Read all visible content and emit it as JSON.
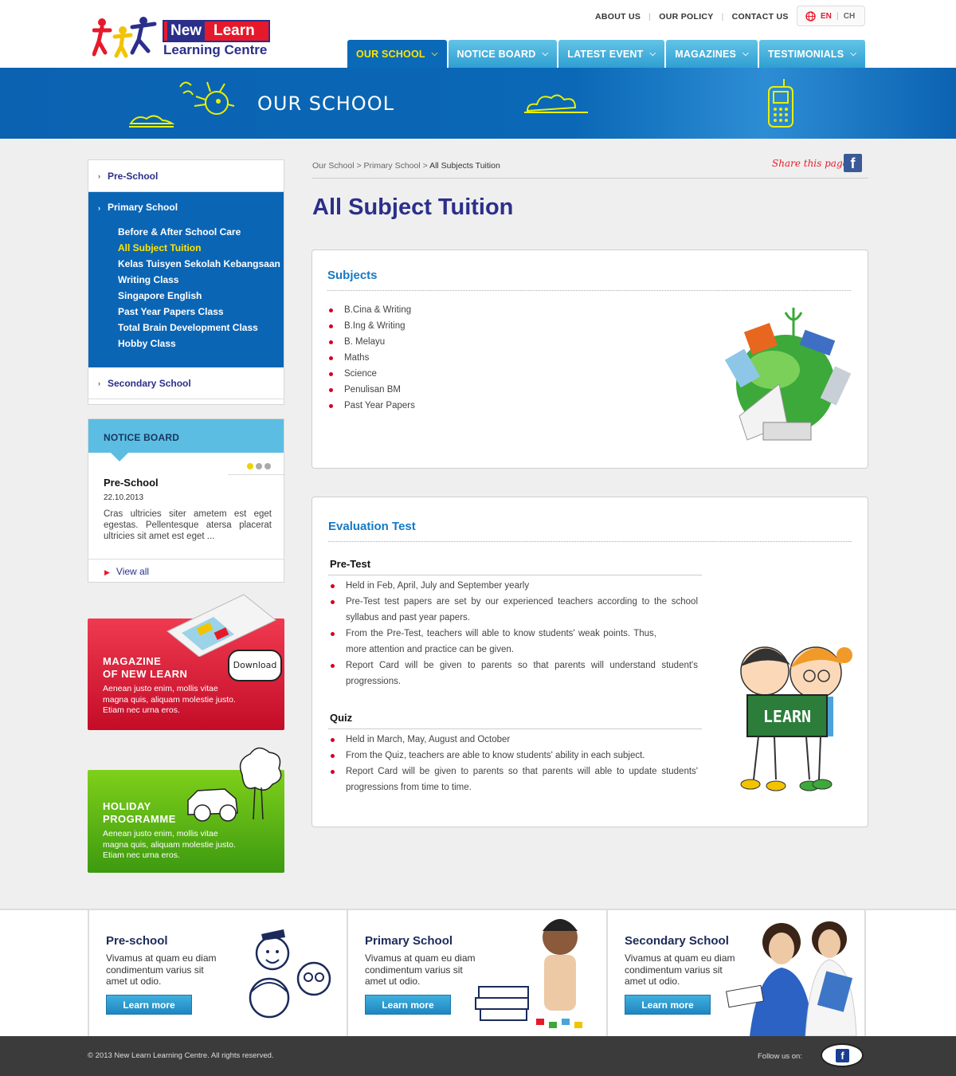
{
  "header": {
    "logo": {
      "word1": "New",
      "word2": "Learn",
      "subtitle": "Learning Centre"
    },
    "top_links": [
      "ABOUT US",
      "OUR POLICY",
      "CONTACT US"
    ],
    "lang": {
      "en": "EN",
      "ch": "CH"
    },
    "nav": [
      {
        "label": "OUR SCHOOL",
        "active": true
      },
      {
        "label": "NOTICE BOARD",
        "active": false
      },
      {
        "label": "LATEST EVENT",
        "active": false
      },
      {
        "label": "MAGAZINES",
        "active": false
      },
      {
        "label": "TESTIMONIALS",
        "active": false
      }
    ]
  },
  "banner": {
    "title": "OUR SCHOOL"
  },
  "sidebar": {
    "menu": {
      "preschool": "Pre-School",
      "primary": "Primary School",
      "primary_items": [
        "Before & After School Care",
        "All Subject Tuition",
        "Kelas Tuisyen Sekolah Kebangsaan",
        "Writing Class",
        "Singapore English",
        "Past Year Papers Class",
        "Total Brain Development Class",
        "Hobby Class"
      ],
      "active_item": "All Subject Tuition",
      "secondary": "Secondary School"
    },
    "notice": {
      "header": "NOTICE BOARD",
      "title": "Pre-School",
      "date": "22.10.2013",
      "text": "Cras ultricies siter ametem est eget egestas. Pellentesque atersa placerat ultricies sit amet est eget ...",
      "view_all": "View all"
    },
    "magazine": {
      "title1": "MAGAZINE",
      "title2": "OF NEW LEARN",
      "text": "Aenean justo enim, mollis vitae magna quis, aliquam molestie justo. Etiam nec urna eros.",
      "download": "Download"
    },
    "holiday": {
      "title1": "HOLIDAY",
      "title2": "PROGRAMME",
      "text": "Aenean justo enim, mollis vitae magna quis, aliquam molestie justo. Etiam nec urna eros."
    }
  },
  "main": {
    "breadcrumb": {
      "a": "Our School",
      "b": "Primary School",
      "c": "All Subjects Tuition",
      "sep": " > "
    },
    "share": "Share this page:",
    "title": "All Subject Tuition",
    "subjects": {
      "heading": "Subjects",
      "items": [
        "B.Cina & Writing",
        "B.Ing & Writing",
        "B. Melayu",
        "Maths",
        "Science",
        "Penulisan BM",
        "Past Year Papers"
      ]
    },
    "evaluation": {
      "heading": "Evaluation Test",
      "pretest": {
        "heading": "Pre-Test",
        "items": [
          "Held in Feb, April, July and September yearly",
          "Pre-Test test papers are set by our experienced teachers according to the school syllabus and past year papers.",
          "From the Pre-Test, teachers will able to know students' weak points. Thus, more attention and practice can be given.",
          "Report Card will be given to parents so that parents will understand student's progressions."
        ]
      },
      "quiz": {
        "heading": "Quiz",
        "items": [
          "Held in March, May, August and October",
          "From the Quiz, teachers are able to know students' ability in each subject.",
          "Report Card will be given to parents so that parents will able to update students' progressions from time to time."
        ]
      },
      "board_text": "LEARN"
    }
  },
  "footer_boxes": [
    {
      "title": "Pre-school",
      "text": "Vivamus at quam eu diam condimentum varius sit amet ut odio.",
      "button": "Learn more"
    },
    {
      "title": "Primary School",
      "text": "Vivamus at quam eu diam condimentum varius sit amet ut odio.",
      "button": "Learn more"
    },
    {
      "title": "Secondary School",
      "text": "Vivamus at quam eu diam condimentum varius sit amet ut odio.",
      "button": "Learn more"
    }
  ],
  "footer": {
    "copyright": "© 2013 New Learn Learning Centre. All rights reserved.",
    "follow": "Follow us on:"
  },
  "colors": {
    "brand_blue": "#2b2f8a",
    "nav_blue": "#2f9fd2",
    "active_nav": "#0b6ab8",
    "accent_red": "#e6192b",
    "highlight_yellow": "#ffe500"
  }
}
